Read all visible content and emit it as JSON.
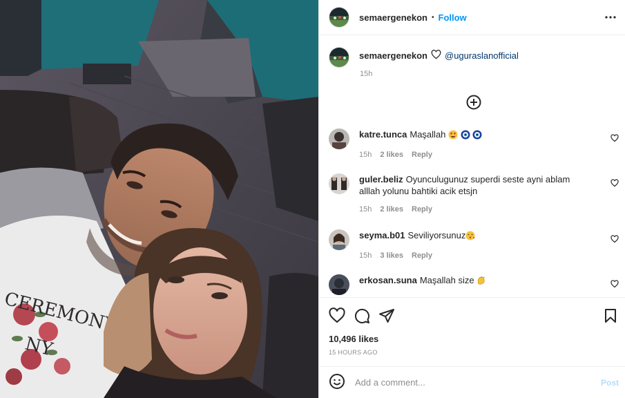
{
  "post": {
    "author": "semaergenekon",
    "dot": "•",
    "follow_label": "Follow",
    "more_icon": "more-horizontal-icon"
  },
  "caption": {
    "author": "semaergenekon",
    "heart_icon": "heart-outline-icon",
    "mention": "@uguraslanofficial",
    "time": "15h"
  },
  "load_more_icon": "plus-circle-icon",
  "comments": [
    {
      "user": "katre.tunca",
      "text": "Maşallah",
      "emojis": [
        "heart-eyes-emoji",
        "evil-eye-emoji",
        "evil-eye-emoji"
      ],
      "time": "15h",
      "likes": "2 likes",
      "reply": "Reply"
    },
    {
      "user": "guler.beliz",
      "text": "Oyunculugunuz superdi seste ayni ablam alllah yolunu bahtiki acik etsjn",
      "emojis": [],
      "time": "15h",
      "likes": "2 likes",
      "reply": "Reply"
    },
    {
      "user": "seyma.b01",
      "text": "Seviliyorsunuz",
      "emojis": [
        "kissing-face-emoji"
      ],
      "time": "15h",
      "likes": "3 likes",
      "reply": "Reply"
    },
    {
      "user": "erkosan.suna",
      "text": "Maşallah size",
      "emojis": [
        "clapping-hands-emoji"
      ],
      "time": "",
      "likes": "",
      "reply": ""
    }
  ],
  "actions": {
    "like_icon": "heart-outline-icon",
    "comment_icon": "comment-icon",
    "share_icon": "send-icon",
    "save_icon": "bookmark-icon",
    "likes_count": "10,496 likes",
    "date": "15 HOURS AGO"
  },
  "add_comment": {
    "emoji_icon": "smiley-icon",
    "placeholder": "Add a comment...",
    "value": "",
    "post_label": "Post"
  },
  "colors": {
    "link": "#0095f6",
    "mention": "#00376b",
    "muted": "#8e8e8e",
    "post_disabled": "#b2dffc",
    "wall_teal": "#1e6f78"
  }
}
